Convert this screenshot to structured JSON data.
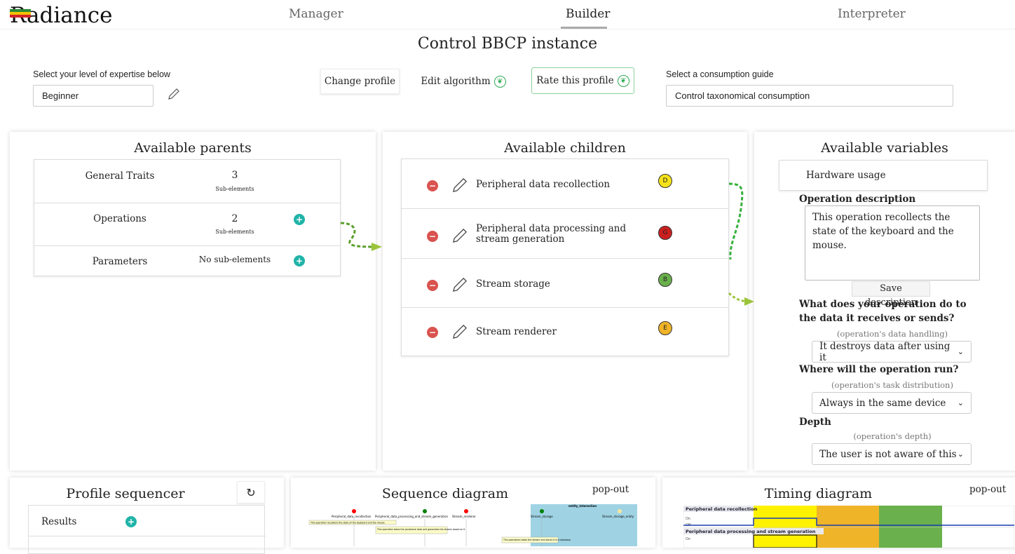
{
  "app": {
    "logo": "Radiance"
  },
  "nav": {
    "tabs": [
      "Manager",
      "Builder",
      "Interpreter"
    ],
    "active": "Builder"
  },
  "page": {
    "title": "Control BBCP instance"
  },
  "expertise": {
    "label": "Select your level of expertise below",
    "value": "Beginner"
  },
  "toolbar": {
    "change_profile": "Change profile",
    "edit_algorithm": "Edit algorithm",
    "rate_profile": "Rate this profile"
  },
  "guide": {
    "label": "Select a consumption guide",
    "value": "Control taxonomical consumption"
  },
  "parents": {
    "title": "Available parents",
    "items": [
      {
        "name": "General Traits",
        "count": "3",
        "sub": "Sub-elements",
        "add": false
      },
      {
        "name": "Operations",
        "count": "2",
        "sub": "Sub-elements",
        "add": true
      },
      {
        "name": "Parameters",
        "count": "",
        "sub": "No sub-elements",
        "add": true
      }
    ]
  },
  "children": {
    "title": "Available children",
    "items": [
      {
        "name": "Peripheral data recollection",
        "grade": "D",
        "color": "#f5e21b"
      },
      {
        "name": "Peripheral data processing and stream generation",
        "grade": "G",
        "color": "#cc1f1f"
      },
      {
        "name": "Stream storage",
        "grade": "B",
        "color": "#6ab04c"
      },
      {
        "name": "Stream renderer",
        "grade": "E",
        "color": "#f0b429"
      }
    ]
  },
  "variables": {
    "title": "Available variables",
    "hardware": "Hardware usage",
    "op_desc_label": "Operation description",
    "op_desc_value": "This operation recollects the state of the keyboard and the mouse.",
    "save": "Save description",
    "q1": "What does your operation do to the data it receives or sends?",
    "q1_hint": "(operation's data handling)",
    "q1_value": "It destroys data after using it",
    "q2": "Where will the operation run?",
    "q2_hint": "(operation's task distribution)",
    "q2_value": "Always in the same device",
    "q3": "Depth",
    "q3_hint": "(operation's depth)",
    "q3_value": "The user is not aware of this c"
  },
  "sequencer": {
    "title": "Profile sequencer",
    "results": "Results"
  },
  "sequence": {
    "title": "Sequence diagram",
    "popout": "pop-out",
    "labels": [
      "Peripheral_data_recollection",
      "Peripheral_data_processing_and_stream_generation",
      "Stream_renderer",
      "Stream_storage",
      "Stream_storage_entity",
      "entity_interaction"
    ],
    "notes": [
      "This operation recollects the state of the keyboard and the mouse.",
      "This operation takes the peripheral data and generates the stream based on it",
      "This operations takes the stream and stores it in a database"
    ]
  },
  "timing": {
    "title": "Timing diagram",
    "popout": "pop-out",
    "rows": [
      "Peripheral data recollection",
      "Peripheral data processing and stream generation"
    ],
    "states": [
      "On",
      "Off",
      "On"
    ]
  }
}
